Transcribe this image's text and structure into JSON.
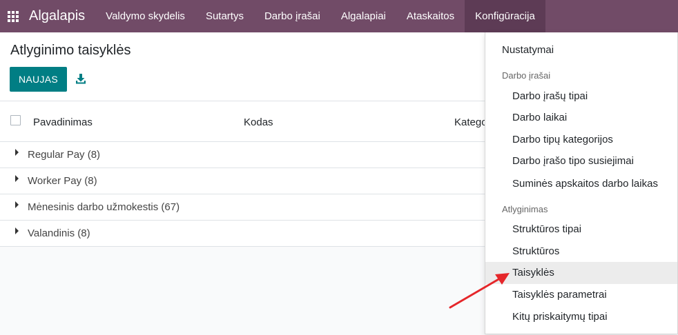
{
  "navbar": {
    "brand": "Algalapis",
    "items": [
      "Valdymo skydelis",
      "Sutartys",
      "Darbo įrašai",
      "Algalapiai",
      "Ataskaitos",
      "Konfigūracija"
    ]
  },
  "control_panel": {
    "title": "Atlyginimo taisyklės",
    "new_button": "NAUJAS"
  },
  "list": {
    "columns": [
      "Pavadinimas",
      "Kodas",
      "Katego"
    ],
    "groups": [
      "Regular Pay (8)",
      "Worker Pay (8)",
      "Mėnesinis darbo užmokestis (67)",
      "Valandinis (8)"
    ]
  },
  "dropdown": {
    "settings": "Nustatymai",
    "section_work_entries": "Darbo įrašai",
    "work_entry_items": [
      "Darbo įrašų tipai",
      "Darbo laikai",
      "Darbo tipų kategorijos",
      "Darbo įrašo tipo susiejimai",
      "Suminės apskaitos darbo laikas"
    ],
    "section_salary": "Atlyginimas",
    "salary_items": [
      "Struktūros tipai",
      "Struktūros",
      "Taisyklės",
      "Taisyklės parametrai",
      "Kitų priskaitymų tipai"
    ]
  },
  "colors": {
    "navbar": "#714b67",
    "primary_button": "#017e84",
    "annotation_arrow": "#e5262a"
  }
}
